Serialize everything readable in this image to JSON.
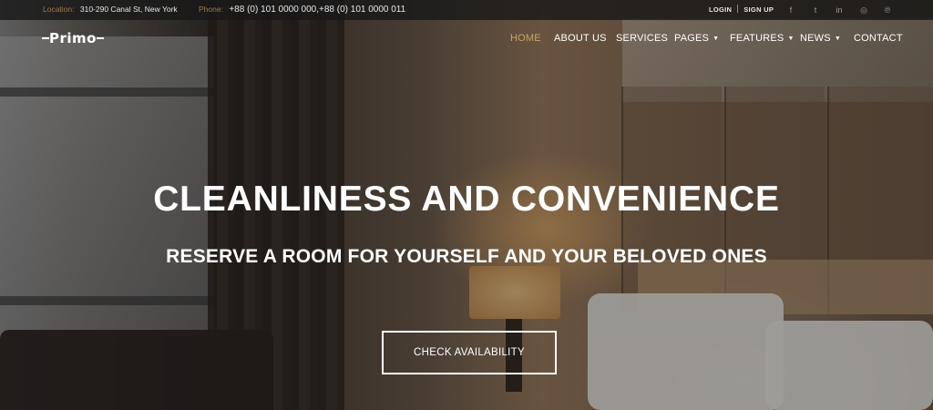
{
  "topbar": {
    "location_label": "Location:",
    "location_value": "310-290 Canal St, New York",
    "phone_label": "Phone:",
    "phone_value": "+88 (0) 101 0000 000,+88 (0) 101 0000 011",
    "login": "LOGIN",
    "signup": "SIGN UP",
    "socials": [
      {
        "icon": "facebook-icon",
        "glyph": "f"
      },
      {
        "icon": "twitter-icon",
        "glyph": "t"
      },
      {
        "icon": "linkedin-icon",
        "glyph": "in"
      },
      {
        "icon": "instagram-icon",
        "glyph": "◎"
      },
      {
        "icon": "pinterest-icon",
        "glyph": "℗"
      }
    ]
  },
  "brand": {
    "logo_text": "Primo"
  },
  "nav": {
    "items": [
      {
        "label": "HOME",
        "active": true
      },
      {
        "label": "ABOUT US",
        "active": false
      },
      {
        "label": "SERVICES",
        "active": false
      },
      {
        "label": "PAGES",
        "active": false,
        "dropdown": true
      },
      {
        "label": "FEATURES",
        "active": false,
        "dropdown": true
      },
      {
        "label": "NEWS",
        "active": false,
        "dropdown": true
      },
      {
        "label": "CONTACT",
        "active": false
      }
    ]
  },
  "hero": {
    "headline": "CLEANLINESS AND CONVENIENCE",
    "subheadline": "RESERVE A ROOM FOR YOURSELF AND YOUR BELOVED ONES",
    "cta_label": "CHECK AVAILABILITY"
  },
  "colors": {
    "accent": "#c9a36b",
    "topbar_bg": "#191919",
    "text": "#ffffff"
  }
}
